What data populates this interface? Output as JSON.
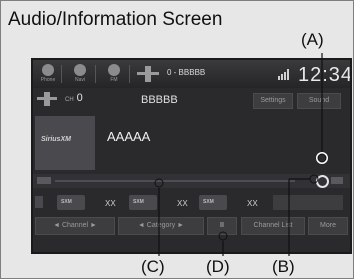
{
  "title": "Audio/Information Screen",
  "annotations": {
    "a": "(A)",
    "b": "(B)",
    "c": "(C)",
    "d": "(D)"
  },
  "topbar": {
    "icons": [
      {
        "label": "Phone",
        "icon": "phone-icon"
      },
      {
        "label": "Navi",
        "icon": "navigation-icon"
      },
      {
        "label": "FM",
        "icon": "radio-icon"
      }
    ],
    "source_text": "0 - BBBBB",
    "clock": "12:34"
  },
  "channel": {
    "prefix": "CH",
    "number": "0",
    "name": "BBBBB"
  },
  "buttons": {
    "settings": "Settings",
    "sound": "Sound"
  },
  "logo": "SiriusXM",
  "track": "AAAAA",
  "presets": [
    {
      "label": "XX"
    },
    {
      "label": "XX"
    },
    {
      "label": "XX"
    }
  ],
  "bottom": {
    "channel": "Channel",
    "category": "Category",
    "pause": "II",
    "channel_list": "Channel List",
    "more": "More"
  },
  "colors": {
    "screen_bg": "#2a2a2c",
    "text": "#e0e0e0"
  }
}
